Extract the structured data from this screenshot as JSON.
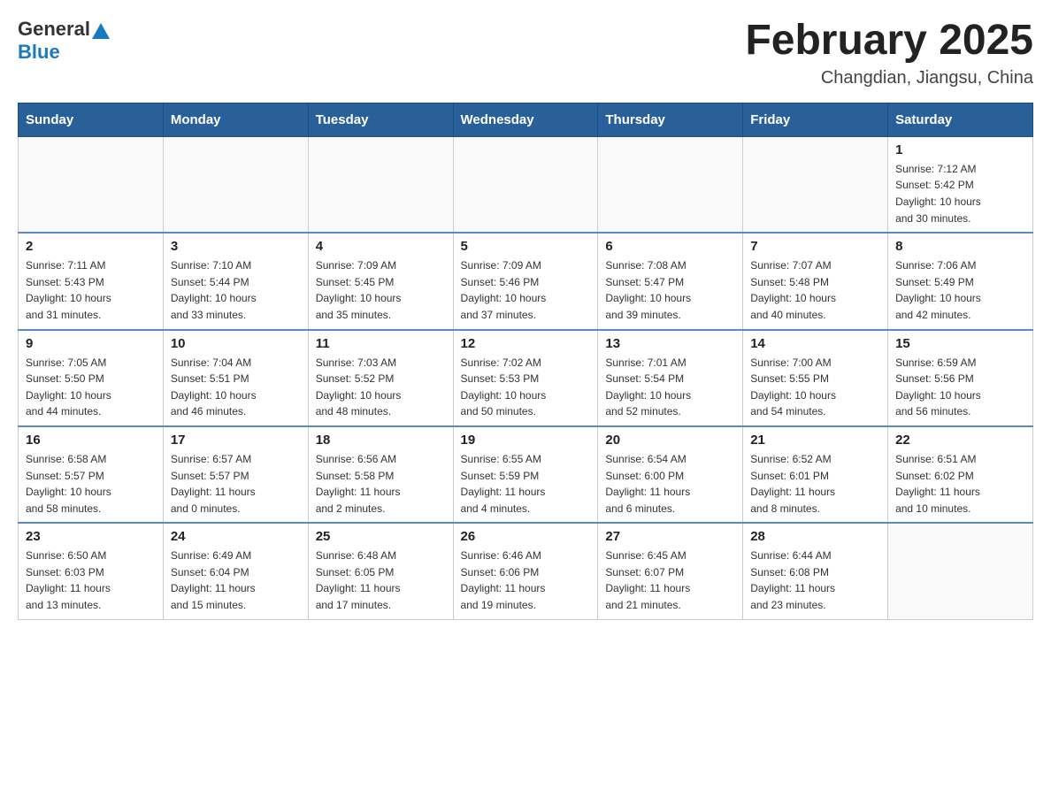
{
  "header": {
    "title": "February 2025",
    "subtitle": "Changdian, Jiangsu, China",
    "logo_general": "General",
    "logo_blue": "Blue"
  },
  "weekdays": [
    "Sunday",
    "Monday",
    "Tuesday",
    "Wednesday",
    "Thursday",
    "Friday",
    "Saturday"
  ],
  "weeks": [
    [
      {
        "day": "",
        "info": ""
      },
      {
        "day": "",
        "info": ""
      },
      {
        "day": "",
        "info": ""
      },
      {
        "day": "",
        "info": ""
      },
      {
        "day": "",
        "info": ""
      },
      {
        "day": "",
        "info": ""
      },
      {
        "day": "1",
        "info": "Sunrise: 7:12 AM\nSunset: 5:42 PM\nDaylight: 10 hours\nand 30 minutes."
      }
    ],
    [
      {
        "day": "2",
        "info": "Sunrise: 7:11 AM\nSunset: 5:43 PM\nDaylight: 10 hours\nand 31 minutes."
      },
      {
        "day": "3",
        "info": "Sunrise: 7:10 AM\nSunset: 5:44 PM\nDaylight: 10 hours\nand 33 minutes."
      },
      {
        "day": "4",
        "info": "Sunrise: 7:09 AM\nSunset: 5:45 PM\nDaylight: 10 hours\nand 35 minutes."
      },
      {
        "day": "5",
        "info": "Sunrise: 7:09 AM\nSunset: 5:46 PM\nDaylight: 10 hours\nand 37 minutes."
      },
      {
        "day": "6",
        "info": "Sunrise: 7:08 AM\nSunset: 5:47 PM\nDaylight: 10 hours\nand 39 minutes."
      },
      {
        "day": "7",
        "info": "Sunrise: 7:07 AM\nSunset: 5:48 PM\nDaylight: 10 hours\nand 40 minutes."
      },
      {
        "day": "8",
        "info": "Sunrise: 7:06 AM\nSunset: 5:49 PM\nDaylight: 10 hours\nand 42 minutes."
      }
    ],
    [
      {
        "day": "9",
        "info": "Sunrise: 7:05 AM\nSunset: 5:50 PM\nDaylight: 10 hours\nand 44 minutes."
      },
      {
        "day": "10",
        "info": "Sunrise: 7:04 AM\nSunset: 5:51 PM\nDaylight: 10 hours\nand 46 minutes."
      },
      {
        "day": "11",
        "info": "Sunrise: 7:03 AM\nSunset: 5:52 PM\nDaylight: 10 hours\nand 48 minutes."
      },
      {
        "day": "12",
        "info": "Sunrise: 7:02 AM\nSunset: 5:53 PM\nDaylight: 10 hours\nand 50 minutes."
      },
      {
        "day": "13",
        "info": "Sunrise: 7:01 AM\nSunset: 5:54 PM\nDaylight: 10 hours\nand 52 minutes."
      },
      {
        "day": "14",
        "info": "Sunrise: 7:00 AM\nSunset: 5:55 PM\nDaylight: 10 hours\nand 54 minutes."
      },
      {
        "day": "15",
        "info": "Sunrise: 6:59 AM\nSunset: 5:56 PM\nDaylight: 10 hours\nand 56 minutes."
      }
    ],
    [
      {
        "day": "16",
        "info": "Sunrise: 6:58 AM\nSunset: 5:57 PM\nDaylight: 10 hours\nand 58 minutes."
      },
      {
        "day": "17",
        "info": "Sunrise: 6:57 AM\nSunset: 5:57 PM\nDaylight: 11 hours\nand 0 minutes."
      },
      {
        "day": "18",
        "info": "Sunrise: 6:56 AM\nSunset: 5:58 PM\nDaylight: 11 hours\nand 2 minutes."
      },
      {
        "day": "19",
        "info": "Sunrise: 6:55 AM\nSunset: 5:59 PM\nDaylight: 11 hours\nand 4 minutes."
      },
      {
        "day": "20",
        "info": "Sunrise: 6:54 AM\nSunset: 6:00 PM\nDaylight: 11 hours\nand 6 minutes."
      },
      {
        "day": "21",
        "info": "Sunrise: 6:52 AM\nSunset: 6:01 PM\nDaylight: 11 hours\nand 8 minutes."
      },
      {
        "day": "22",
        "info": "Sunrise: 6:51 AM\nSunset: 6:02 PM\nDaylight: 11 hours\nand 10 minutes."
      }
    ],
    [
      {
        "day": "23",
        "info": "Sunrise: 6:50 AM\nSunset: 6:03 PM\nDaylight: 11 hours\nand 13 minutes."
      },
      {
        "day": "24",
        "info": "Sunrise: 6:49 AM\nSunset: 6:04 PM\nDaylight: 11 hours\nand 15 minutes."
      },
      {
        "day": "25",
        "info": "Sunrise: 6:48 AM\nSunset: 6:05 PM\nDaylight: 11 hours\nand 17 minutes."
      },
      {
        "day": "26",
        "info": "Sunrise: 6:46 AM\nSunset: 6:06 PM\nDaylight: 11 hours\nand 19 minutes."
      },
      {
        "day": "27",
        "info": "Sunrise: 6:45 AM\nSunset: 6:07 PM\nDaylight: 11 hours\nand 21 minutes."
      },
      {
        "day": "28",
        "info": "Sunrise: 6:44 AM\nSunset: 6:08 PM\nDaylight: 11 hours\nand 23 minutes."
      },
      {
        "day": "",
        "info": ""
      }
    ]
  ]
}
